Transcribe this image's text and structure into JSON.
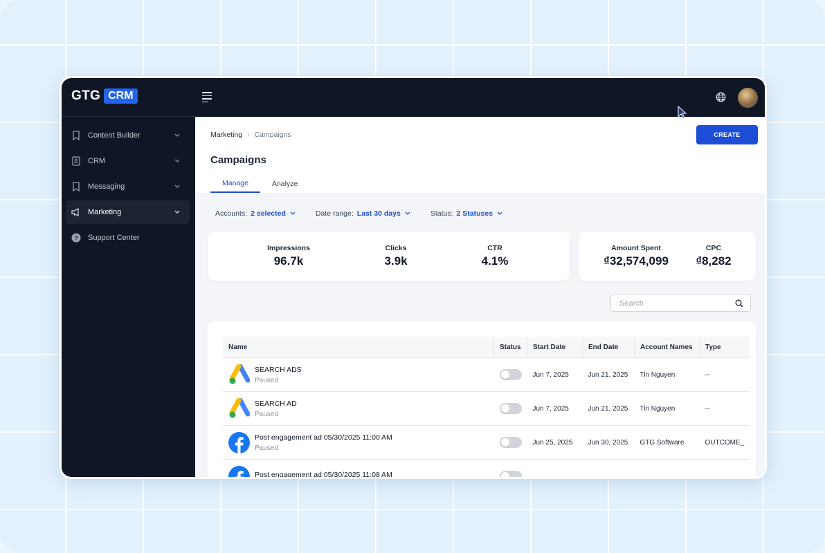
{
  "brand": {
    "name": "GTG",
    "badge": "CRM"
  },
  "sidebar": {
    "items": [
      {
        "label": "Content Builder",
        "icon": "bookmark-icon",
        "has_chevron": true
      },
      {
        "label": "CRM",
        "icon": "contact-card-icon",
        "has_chevron": true
      },
      {
        "label": "Messaging",
        "icon": "bookmark-icon",
        "has_chevron": true
      },
      {
        "label": "Marketing",
        "icon": "megaphone-icon",
        "has_chevron": true,
        "active": true
      },
      {
        "label": "Support Center",
        "icon": "help-circle-icon",
        "has_chevron": false
      }
    ]
  },
  "breadcrumb": {
    "parent": "Marketing",
    "separator": "›",
    "current": "Campaigns"
  },
  "actions": {
    "create_label": "CREATE"
  },
  "page": {
    "title": "Campaigns"
  },
  "tabs": [
    {
      "label": "Manage",
      "active": true
    },
    {
      "label": "Analyze",
      "active": false
    }
  ],
  "filters": {
    "accounts": {
      "label": "Accounts:",
      "value": "2 selected"
    },
    "date_range": {
      "label": "Date range:",
      "value": "Last 30 days"
    },
    "status": {
      "label": "Status:",
      "value": "2 Statuses"
    }
  },
  "stats": {
    "impressions": {
      "label": "Impressions",
      "value": "96.7k"
    },
    "clicks": {
      "label": "Clicks",
      "value": "3.9k"
    },
    "ctr": {
      "label": "CTR",
      "value": "4.1%"
    },
    "amount_spent": {
      "label": "Amount Spent",
      "value": "₫32,574,099"
    },
    "cpc": {
      "label": "CPC",
      "value": "₫8,282"
    }
  },
  "search": {
    "placeholder": "Search"
  },
  "table": {
    "columns": [
      "Name",
      "Status",
      "Start Date",
      "End Date",
      "Account Names",
      "Type"
    ],
    "rows": [
      {
        "logo": "google-ads-icon",
        "name": "SEARCH ADS",
        "state": "Paused",
        "start": "Jun 7, 2025",
        "end": "Jun 21, 2025",
        "account": "Tin Nguyen",
        "type": "--"
      },
      {
        "logo": "google-ads-icon",
        "name": "SEARCH AD",
        "state": "Paused",
        "start": "Jun 7, 2025",
        "end": "Jun 21, 2025",
        "account": "Tin Nguyen",
        "type": "--"
      },
      {
        "logo": "facebook-icon",
        "name": "Post engagement ad 05/30/2025 11:00 AM",
        "state": "Paused",
        "start": "Jun 25, 2025",
        "end": "Jun 30, 2025",
        "account": "GTG Software",
        "type": "OUTCOME_"
      },
      {
        "logo": "facebook-icon",
        "name": "Post engagement ad 05/30/2025 11:08 AM",
        "state": "",
        "start": "",
        "end": "",
        "account": "",
        "type": ""
      }
    ]
  },
  "colors": {
    "accent": "#1d4ed8",
    "sidebar_bg": "#0f1626",
    "page_bg": "#f3f5f9"
  }
}
